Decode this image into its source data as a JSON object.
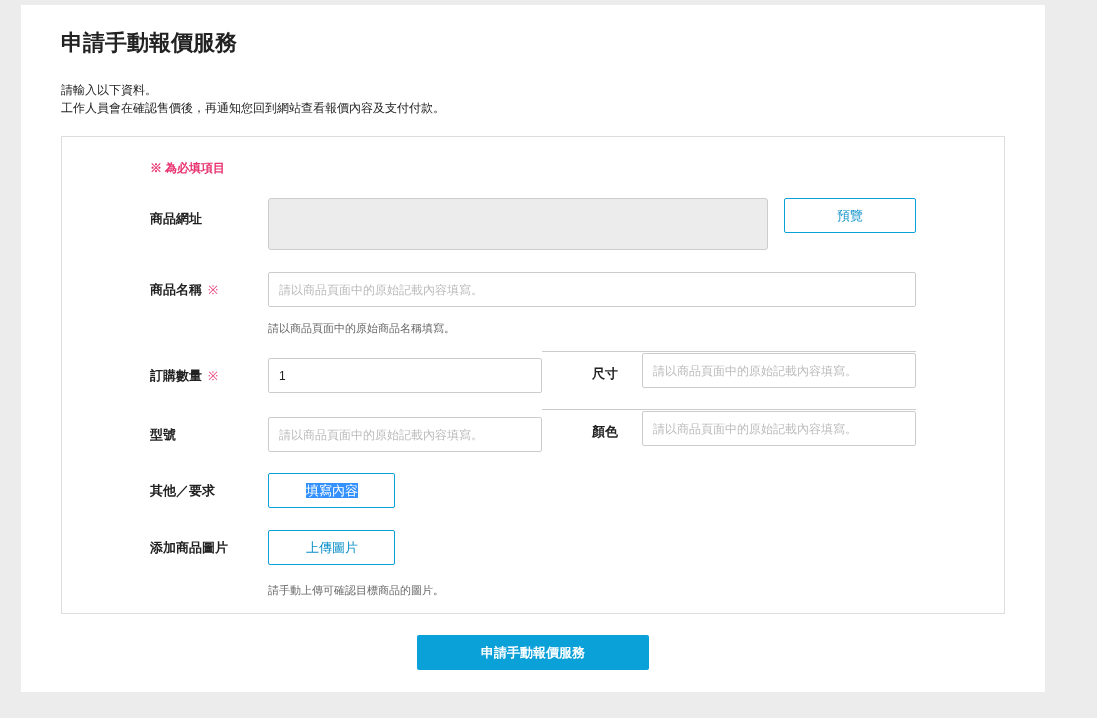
{
  "page_title": "申請手動報價服務",
  "intro": [
    "請輸入以下資料。",
    "工作人員會在確認售價後，再通知您回到網站查看報價內容及支付付款。"
  ],
  "required_note": "※ 為必填項目",
  "url_field": {
    "label": "商品網址",
    "disabled": true,
    "button": "預覽"
  },
  "name_field": {
    "label": "商品名稱",
    "required_mark": "※",
    "placeholder": "請以商品頁面中的原始記載內容填寫。",
    "hint": "請以商品頁面中的原始商品名稱填寫。"
  },
  "quantity_field": {
    "label": "訂購數量",
    "required_mark": "※",
    "value": "1"
  },
  "size_field": {
    "label": "尺寸",
    "placeholder": "請以商品頁面中的原始記載內容填寫。"
  },
  "model_field": {
    "label": "型號",
    "placeholder": "請以商品頁面中的原始記載內容填寫。"
  },
  "color_field": {
    "label": "顏色",
    "placeholder": "請以商品頁面中的原始記載內容填寫。"
  },
  "other_requests": {
    "label": "其他／要求",
    "button": "填寫內容",
    "text_highlighted": true
  },
  "image_upload": {
    "label": "添加商品圖片",
    "button": "上傳圖片",
    "hint": "請手動上傳可確認目標商品的圖片。"
  },
  "submit_button": "申請手動報價服務"
}
